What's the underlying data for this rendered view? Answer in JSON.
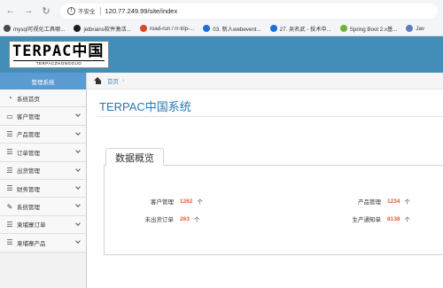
{
  "browser": {
    "insecure_label": "不安全",
    "url": "120.77.249.99/site/index",
    "bookmarks": [
      {
        "label": "mysql可视化工具哪...",
        "color": "#4a4a4a"
      },
      {
        "label": "jetbrains软件激活...",
        "color": "#1d1d1d"
      },
      {
        "label": "road-run / rr-trip-...",
        "color": "#e24329"
      },
      {
        "label": "03. 新人webevent...",
        "color": "#1e6fd9"
      },
      {
        "label": "27. 吴名武 - 技术中...",
        "color": "#1e6fd9"
      },
      {
        "label": "Spring Boot 2.x基...",
        "color": "#6db33f"
      },
      {
        "label": "Jav",
        "color": "#5b7fbd"
      }
    ]
  },
  "logo": {
    "main": "TERPAC中国",
    "sub": "TERPACZHONGGUO"
  },
  "sidebar": {
    "header": "管理系统",
    "items": [
      {
        "label": "系统首页",
        "icon": "dashboard-icon",
        "glyph": "◔",
        "expandable": false
      },
      {
        "label": "客户管理",
        "icon": "desktop-icon",
        "glyph": "▭",
        "expandable": true
      },
      {
        "label": "产品管理",
        "icon": "list-icon",
        "glyph": "☰",
        "expandable": true
      },
      {
        "label": "订单管理",
        "icon": "list-icon",
        "glyph": "☰",
        "expandable": true
      },
      {
        "label": "出货管理",
        "icon": "list-icon",
        "glyph": "☰",
        "expandable": true
      },
      {
        "label": "财务管理",
        "icon": "list-icon",
        "glyph": "☰",
        "expandable": true
      },
      {
        "label": "系统管理",
        "icon": "edit-icon",
        "glyph": "✎",
        "expandable": true
      },
      {
        "label": "柬埔寨订单",
        "icon": "list-icon",
        "glyph": "☰",
        "expandable": true
      },
      {
        "label": "柬埔寨产品",
        "icon": "list-icon",
        "glyph": "☰",
        "expandable": true
      }
    ]
  },
  "breadcrumb": {
    "home": "首页",
    "sep": "›"
  },
  "page": {
    "title": "TERPAC中国系统",
    "tab": "数据概览"
  },
  "stats": {
    "unit": "个",
    "customer": {
      "label": "客户管理",
      "value": "1262"
    },
    "product": {
      "label": "产品管理",
      "value": "1234"
    },
    "unshipped": {
      "label": "未出货订单",
      "value": "263"
    },
    "production": {
      "label": "生产通知单",
      "value": "8138"
    }
  },
  "colors": {
    "header": "#438eb9",
    "sidebar_header": "#5b9bd1",
    "accent_value": "#e25d33",
    "title": "#2679b5"
  }
}
